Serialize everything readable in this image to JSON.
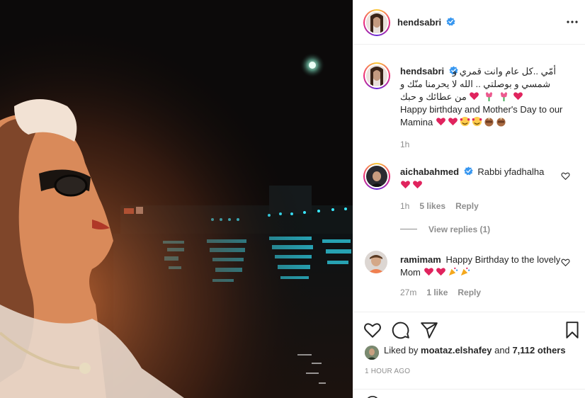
{
  "post": {
    "author": "hendsabri",
    "caption": {
      "arabic_line1": "أمّي ..كل عام وانت قمري و",
      "arabic_line2": "شمسي و بوصلتي .. الله لا يحرمنا منّك و",
      "arabic_line3": "من عطائك و حبك",
      "english": "Happy birthday and Mother's Day to our Mamina",
      "time": "1h"
    },
    "comments": [
      {
        "user": "aichabahmed",
        "verified": true,
        "text": "Rabbi yfadhalha",
        "time": "1h",
        "likes": "5 likes",
        "reply": "Reply"
      },
      {
        "user": "ramimam",
        "verified": false,
        "text": "Happy Birthday to the lovely Mom",
        "time": "27m",
        "likes": "1 like",
        "reply": "Reply"
      }
    ],
    "view_replies": "View replies (1)",
    "liked_by_prefix": "Liked by",
    "liked_by_user": "moataz.elshafey",
    "liked_by_and": "and",
    "liked_by_count": "7,112 others",
    "time_ago": "1 HOUR AGO"
  },
  "icons": {
    "verified": "verified-badge-icon",
    "more": "more-options-icon",
    "like": "heart-icon",
    "comment": "comment-icon",
    "share": "paper-plane-icon",
    "save": "bookmark-icon"
  },
  "colors": {
    "verified": "#3897f0",
    "heart_emoji": "#e0245e",
    "meta": "#8e8e8e",
    "text": "#262626"
  }
}
